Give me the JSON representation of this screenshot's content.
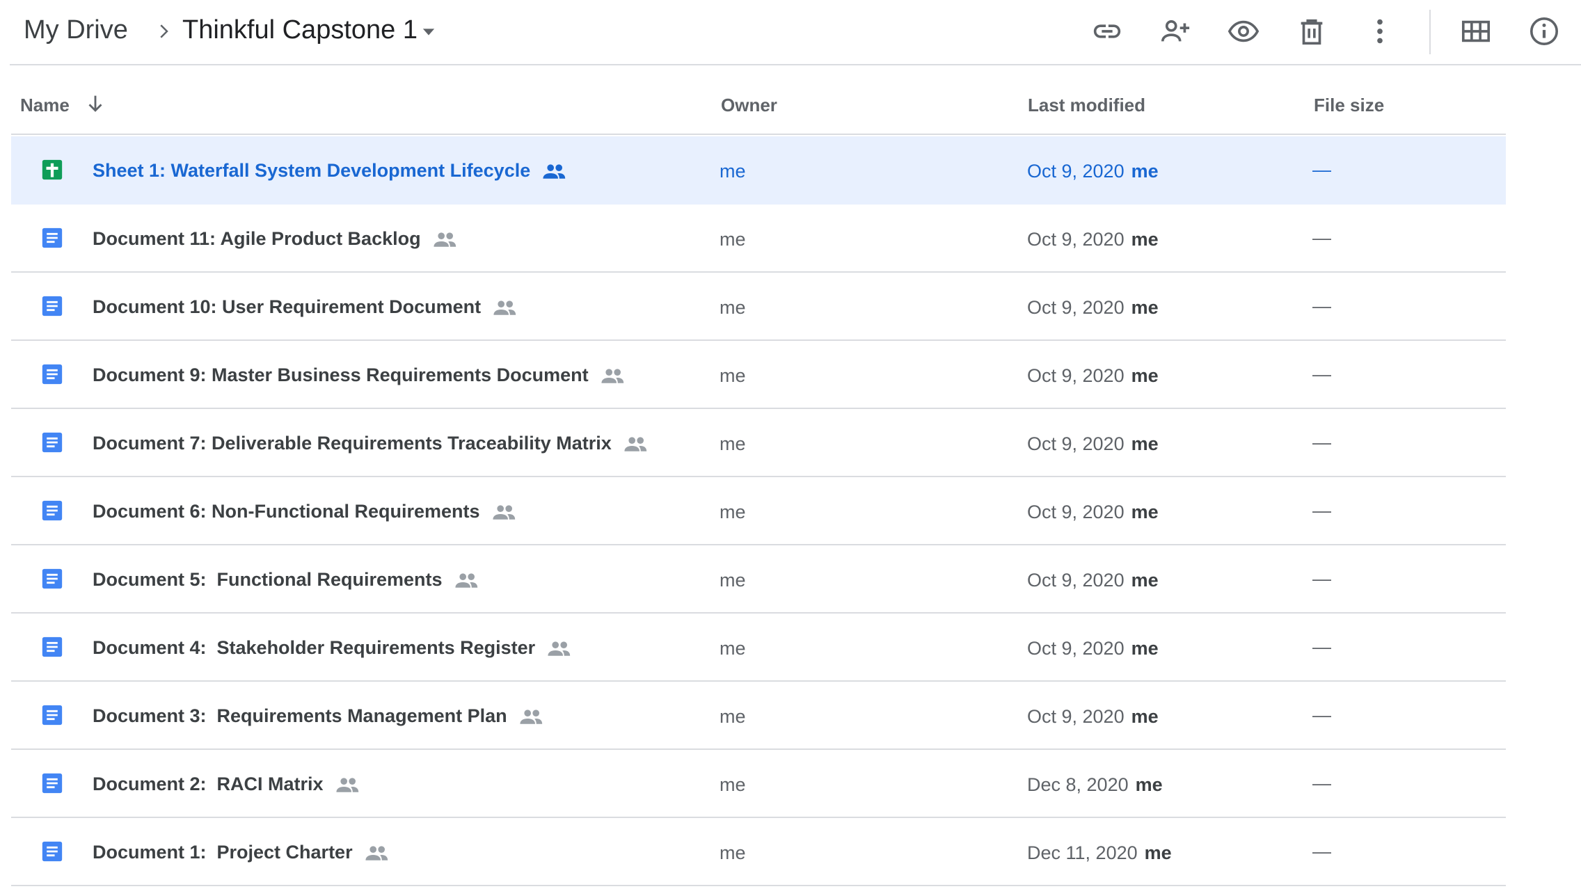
{
  "breadcrumb": {
    "root": "My Drive",
    "current": "Thinkful Capstone 1"
  },
  "toolbar": {
    "buttons": [
      {
        "icon": "link-icon",
        "label": "Get link"
      },
      {
        "icon": "add-person-icon",
        "label": "Share"
      },
      {
        "icon": "eye-icon",
        "label": "Preview"
      },
      {
        "icon": "trash-icon",
        "label": "Remove"
      },
      {
        "icon": "more-vert-icon",
        "label": "More actions"
      },
      {
        "icon": "grid-view-icon",
        "label": "Switch to grid layout"
      },
      {
        "icon": "info-icon",
        "label": "View details"
      }
    ]
  },
  "columns": {
    "name": "Name",
    "owner": "Owner",
    "last_modified": "Last modified",
    "file_size": "File size"
  },
  "colors": {
    "sheets_green": "#0f9d58",
    "docs_blue": "#4285f4",
    "selected_bg": "#e8f0fe",
    "selected_text": "#1967d2"
  },
  "files": [
    {
      "type": "sheet",
      "name": "Sheet 1: Waterfall System Development Lifecycle",
      "owner": "me",
      "modified": "Oct 9, 2020",
      "modified_by": "me",
      "size": "—",
      "selected": true
    },
    {
      "type": "doc",
      "name": "Document 11: Agile Product Backlog",
      "owner": "me",
      "modified": "Oct 9, 2020",
      "modified_by": "me",
      "size": "—"
    },
    {
      "type": "doc",
      "name": "Document 10: User Requirement Document",
      "owner": "me",
      "modified": "Oct 9, 2020",
      "modified_by": "me",
      "size": "—"
    },
    {
      "type": "doc",
      "name": "Document 9: Master Business Requirements Document",
      "owner": "me",
      "modified": "Oct 9, 2020",
      "modified_by": "me",
      "size": "—"
    },
    {
      "type": "doc",
      "name": "Document 7: Deliverable Requirements Traceability Matrix",
      "owner": "me",
      "modified": "Oct 9, 2020",
      "modified_by": "me",
      "size": "—"
    },
    {
      "type": "doc",
      "name": "Document 6: Non-Functional Requirements",
      "owner": "me",
      "modified": "Oct 9, 2020",
      "modified_by": "me",
      "size": "—"
    },
    {
      "type": "doc",
      "name": "Document 5:  Functional Requirements",
      "owner": "me",
      "modified": "Oct 9, 2020",
      "modified_by": "me",
      "size": "—"
    },
    {
      "type": "doc",
      "name": "Document 4:  Stakeholder Requirements Register",
      "owner": "me",
      "modified": "Oct 9, 2020",
      "modified_by": "me",
      "size": "—"
    },
    {
      "type": "doc",
      "name": "Document 3:  Requirements Management Plan",
      "owner": "me",
      "modified": "Oct 9, 2020",
      "modified_by": "me",
      "size": "—"
    },
    {
      "type": "doc",
      "name": "Document 2:  RACI Matrix",
      "owner": "me",
      "modified": "Dec 8, 2020",
      "modified_by": "me",
      "size": "—"
    },
    {
      "type": "doc",
      "name": "Document 1:  Project Charter",
      "owner": "me",
      "modified": "Dec 11, 2020",
      "modified_by": "me",
      "size": "—"
    }
  ]
}
